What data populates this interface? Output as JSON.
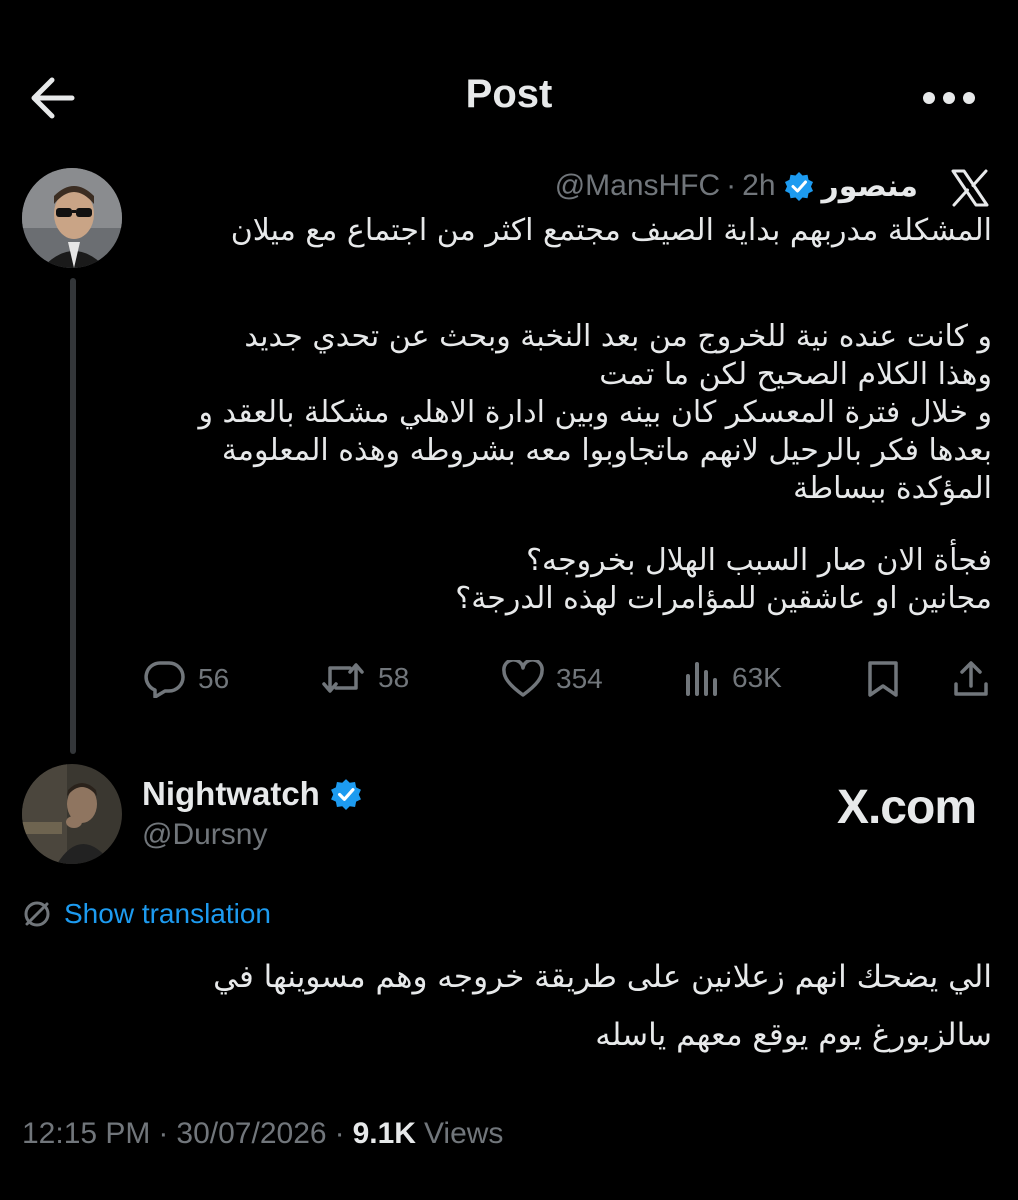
{
  "header": {
    "title": "Post"
  },
  "quoted": {
    "author_name": "منصور",
    "handle": "@MansHFC",
    "separator": "·",
    "time": "2h",
    "lines": [
      "المشكلة مدربهم بداية الصيف مجتمع اكثر من اجتماع مع ميلان",
      "",
      "و كانت عنده نية للخروج من بعد النخبة وبحث عن تحدي جديد",
      "وهذا الكلام الصحيح لكن ما تمت",
      "و خلال فترة المعسكر كان بينه وبين ادارة الاهلي مشكلة بالعقد و",
      "بعدها فكر بالرحيل لانهم ماتجاوبوا معه بشروطه وهذه المعلومة",
      "المؤكدة ببساطة",
      "",
      "فجأة الان صار السبب الهلال بخروجه؟",
      "مجانين او عاشقين للمؤامرات لهذه الدرجة؟"
    ],
    "actions": {
      "replies": "56",
      "reposts": "58",
      "likes": "354",
      "views": "63K"
    }
  },
  "reply": {
    "author_name": "Nightwatch",
    "handle": "@Dursny",
    "watermark": "X.com",
    "translate_label": "Show translation",
    "lines": [
      "الي يضحك انهم زعلانين على طريقة خروجه وهم مسوينها في",
      "سالزبورغ يوم يوقع معهم ياسله"
    ],
    "time": "12:15 PM",
    "date": "30/07/2026",
    "views_count": "9.1K",
    "views_label": "Views",
    "sep": "·"
  },
  "colors": {
    "background": "#000000",
    "text": "#e7e9ea",
    "muted": "#71767b",
    "accent": "#1d9bf0",
    "verified": "#1d9bf0"
  },
  "icons": [
    "back-arrow-icon",
    "more-icon",
    "x-logo-icon",
    "verified-icon",
    "reply-icon",
    "repost-icon",
    "like-icon",
    "views-icon",
    "bookmark-icon",
    "share-icon",
    "translate-icon"
  ]
}
